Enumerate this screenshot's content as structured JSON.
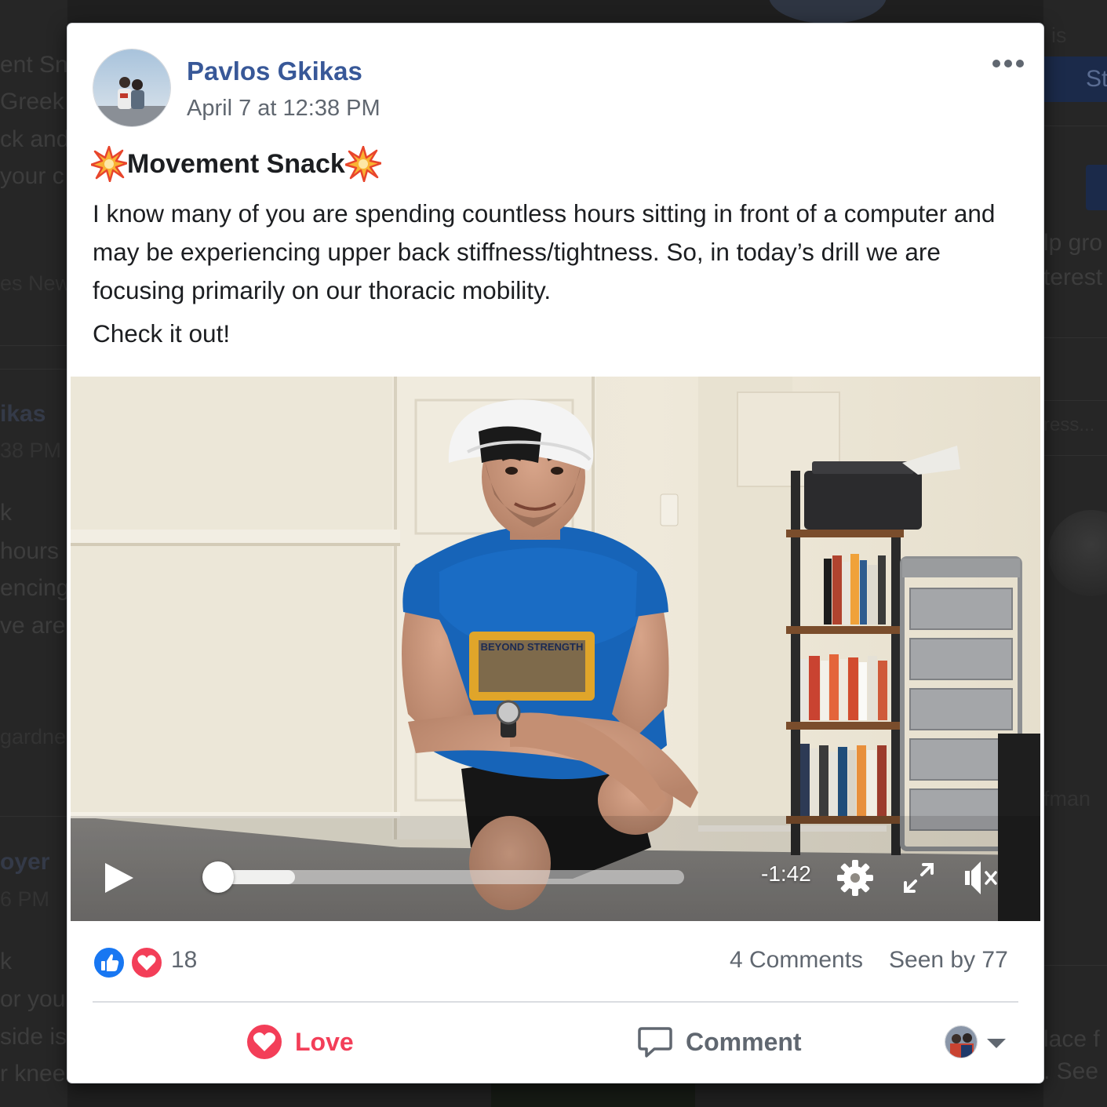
{
  "background": {
    "left_fragments": [
      "ent Sn",
      "Greek",
      "ck and",
      "your c",
      "es New",
      "ikas",
      "38 PM",
      "k",
      "hours",
      "encing",
      "ve are",
      "gardne",
      "oyer",
      "6 PM",
      "k",
      "or you",
      "side is",
      "r knee"
    ],
    "right_fragments": [
      "is",
      "St",
      "lp gro",
      "terest",
      "ress...",
      "fman",
      "lace f",
      ". See"
    ]
  },
  "post": {
    "author": "Pavlos Gkikas",
    "timestamp": "April 7 at 12:38 PM",
    "title": "Movement Snack",
    "title_icon": "collision-icon",
    "body": "I know many of you are spending countless hours sitting in front of a computer and may be experiencing upper back stiffness/tightness. So, in today’s drill we are focusing primarily on our thoracic mobility.",
    "cta": "Check it out!"
  },
  "video": {
    "time_remaining": "-1:42",
    "progress": 0.03,
    "buffered": 0.19,
    "shirt_text": "BEYOND STRENGTH",
    "muted": true
  },
  "footer": {
    "reaction_count": "18",
    "reaction_icons": [
      "like-icon",
      "love-icon"
    ],
    "comments": "4 Comments",
    "seen_by": "Seen by 77",
    "love_label": "Love",
    "comment_label": "Comment"
  },
  "colors": {
    "author_blue": "#385898",
    "love_red": "#f33e58",
    "like_blue": "#1877f2",
    "muted_gray": "#606770"
  }
}
